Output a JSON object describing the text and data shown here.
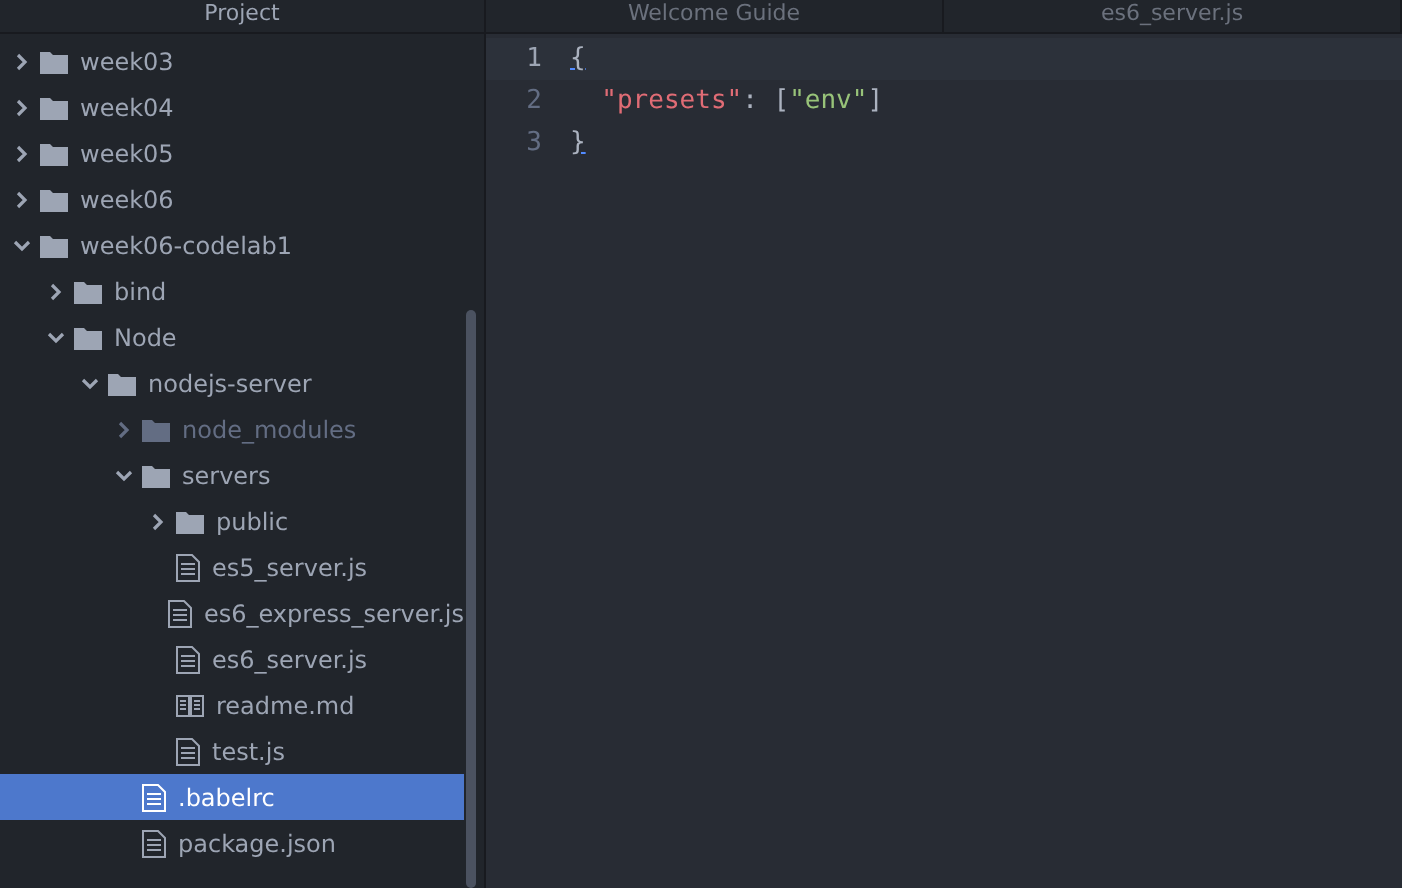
{
  "sidebar": {
    "title": "Project",
    "tree": [
      {
        "label": "week03",
        "kind": "folder",
        "expanded": false,
        "ignored": false,
        "selected": false
      },
      {
        "label": "week04",
        "kind": "folder",
        "expanded": false,
        "ignored": false,
        "selected": false
      },
      {
        "label": "week05",
        "kind": "folder",
        "expanded": false,
        "ignored": false,
        "selected": false
      },
      {
        "label": "week06",
        "kind": "folder",
        "expanded": false,
        "ignored": false,
        "selected": false
      },
      {
        "label": "week06-codelab1",
        "kind": "folder",
        "expanded": true,
        "ignored": false,
        "selected": false,
        "children": [
          {
            "label": "bind",
            "kind": "folder",
            "expanded": false,
            "ignored": false,
            "selected": false
          },
          {
            "label": "Node",
            "kind": "folder",
            "expanded": true,
            "ignored": false,
            "selected": false,
            "children": [
              {
                "label": "nodejs-server",
                "kind": "folder",
                "expanded": true,
                "ignored": false,
                "selected": false,
                "children": [
                  {
                    "label": "node_modules",
                    "kind": "folder",
                    "expanded": false,
                    "ignored": true,
                    "selected": false
                  },
                  {
                    "label": "servers",
                    "kind": "folder",
                    "expanded": true,
                    "ignored": false,
                    "selected": false,
                    "children": [
                      {
                        "label": "public",
                        "kind": "folder",
                        "expanded": false,
                        "ignored": false,
                        "selected": false
                      },
                      {
                        "label": "es5_server.js",
                        "kind": "file",
                        "ignored": false,
                        "selected": false
                      },
                      {
                        "label": "es6_express_server.js",
                        "kind": "file",
                        "ignored": false,
                        "selected": false
                      },
                      {
                        "label": "es6_server.js",
                        "kind": "file",
                        "ignored": false,
                        "selected": false
                      },
                      {
                        "label": "readme.md",
                        "kind": "book",
                        "ignored": false,
                        "selected": false
                      },
                      {
                        "label": "test.js",
                        "kind": "file",
                        "ignored": false,
                        "selected": false
                      }
                    ]
                  },
                  {
                    "label": ".babelrc",
                    "kind": "file",
                    "ignored": false,
                    "selected": true
                  },
                  {
                    "label": "package.json",
                    "kind": "file",
                    "ignored": false,
                    "selected": false
                  }
                ]
              }
            ]
          }
        ]
      }
    ]
  },
  "tabs": [
    {
      "label": "Welcome Guide",
      "selected": false
    },
    {
      "label": "es6_server.js",
      "selected": false
    }
  ],
  "editor": {
    "lines": [
      {
        "number": "1",
        "current": true,
        "tokens": [
          {
            "text": "{",
            "kind": "brace"
          }
        ]
      },
      {
        "number": "2",
        "current": false,
        "tokens": [
          {
            "text": "  \"presets\"",
            "kind": "key"
          },
          {
            "text": ": [",
            "kind": "punct"
          },
          {
            "text": "\"env\"",
            "kind": "string"
          },
          {
            "text": "]",
            "kind": "punct"
          }
        ]
      },
      {
        "number": "3",
        "current": false,
        "tokens": [
          {
            "text": "}",
            "kind": "brace"
          }
        ]
      }
    ]
  }
}
